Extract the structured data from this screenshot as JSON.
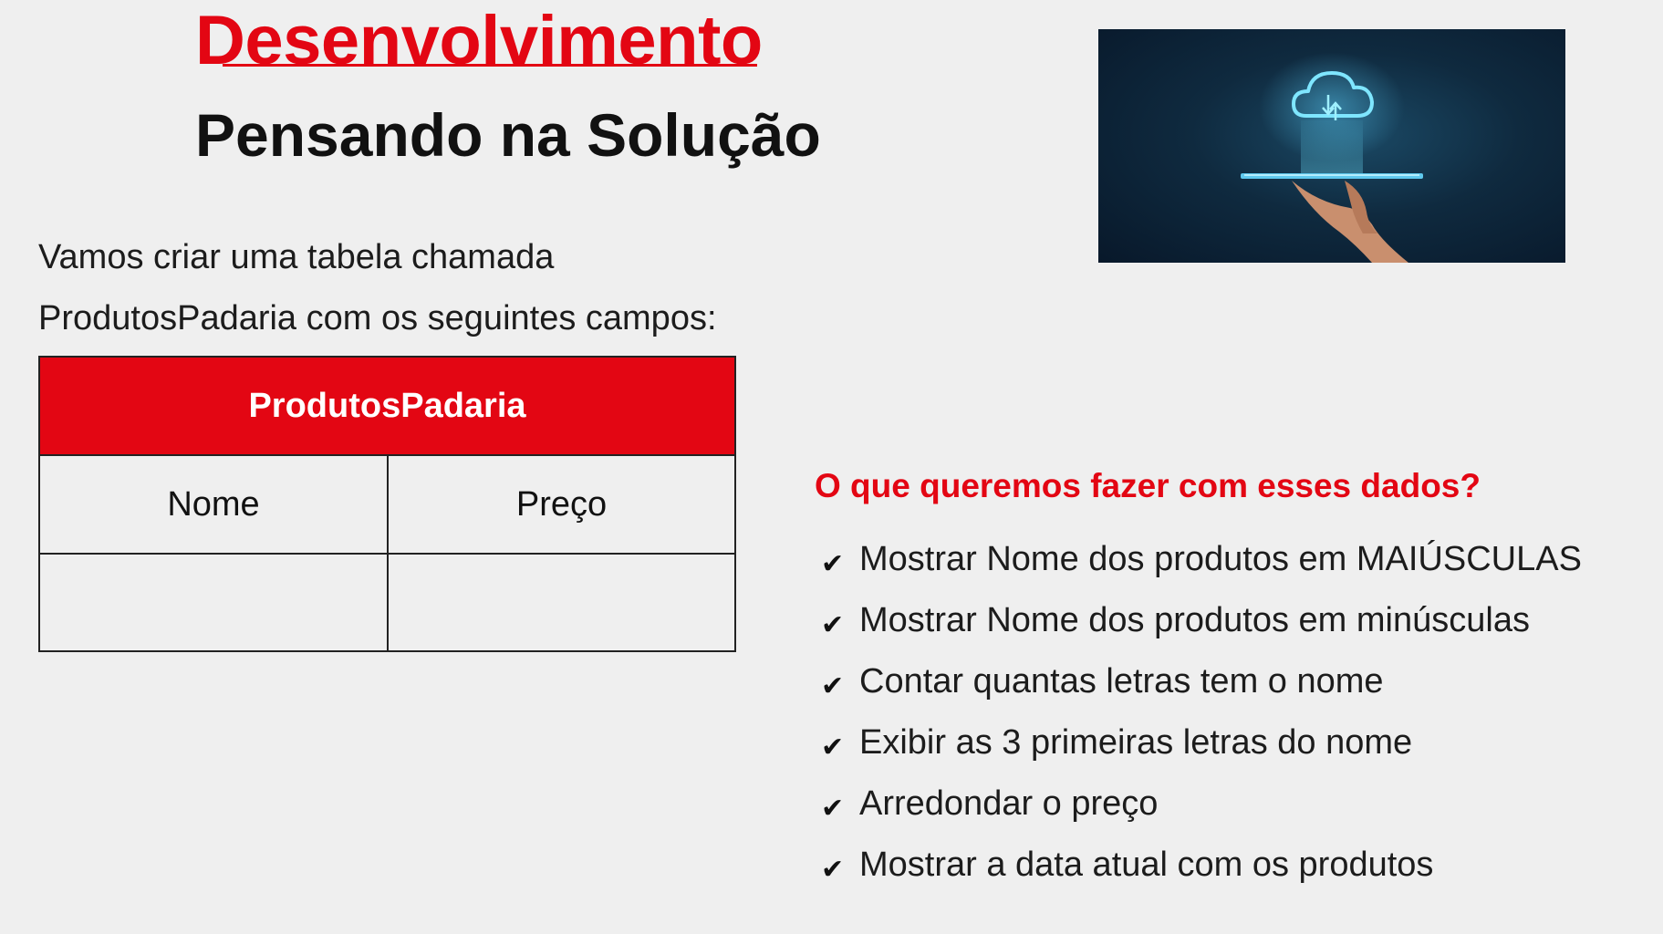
{
  "slide": {
    "title": "Desenvolvimento",
    "subtitle": "Pensando na Solução",
    "intro_lines": [
      "Vamos criar uma tabela chamada",
      "ProdutosPadaria com os seguintes campos:"
    ],
    "table": {
      "name": "ProdutosPadaria",
      "columns": [
        "Nome",
        "Preço"
      ],
      "rows": [
        [
          "",
          ""
        ]
      ]
    },
    "image": {
      "icon": "cloud-sync-on-tablet-hand-icon"
    },
    "question": "O que queremos fazer com esses dados?",
    "checklist": [
      "Mostrar Nome dos produtos em MAIÚSCULAS",
      "Mostrar Nome dos produtos em minúsculas",
      "Contar quantas letras tem o nome",
      "Exibir as 3 primeiras letras do nome",
      "Arredondar o preço",
      "Mostrar a data atual com os produtos"
    ],
    "check_glyph": "✔",
    "colors": {
      "accent": "#e30613",
      "background": "#efefef",
      "text": "#111111"
    }
  }
}
